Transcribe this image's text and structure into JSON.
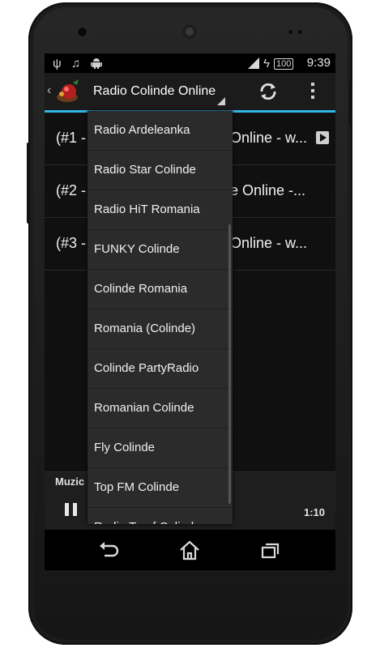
{
  "status_bar": {
    "icons": [
      "usb-icon",
      "music-note-icon",
      "android-debug-icon",
      "cell-signal-icon",
      "charging-icon",
      "battery-icon"
    ],
    "battery_level": "100",
    "time": "9:39"
  },
  "action_bar": {
    "title": "Radio Colinde Online",
    "accent_color": "#33b5e5"
  },
  "list": {
    "rows": [
      {
        "num": "(#1 -",
        "suffix": "Online - w..."
      },
      {
        "num": "(#2 -",
        "suffix": "e Online -..."
      },
      {
        "num": "(#3 -",
        "suffix": "Online - w..."
      }
    ]
  },
  "dropdown": {
    "items": [
      "Radio Ardeleanka",
      "Radio Star Colinde",
      "Radio HiT Romania",
      "FUNKY Colinde",
      "Colinde Romania",
      "Romania (Colinde)",
      "Colinde PartyRadio",
      "Romanian Colinde",
      "Fly Colinde",
      "Top FM Colinde",
      "Radio Taraf Colinde"
    ]
  },
  "player": {
    "label": "Muzic",
    "elapsed": "1:10"
  }
}
